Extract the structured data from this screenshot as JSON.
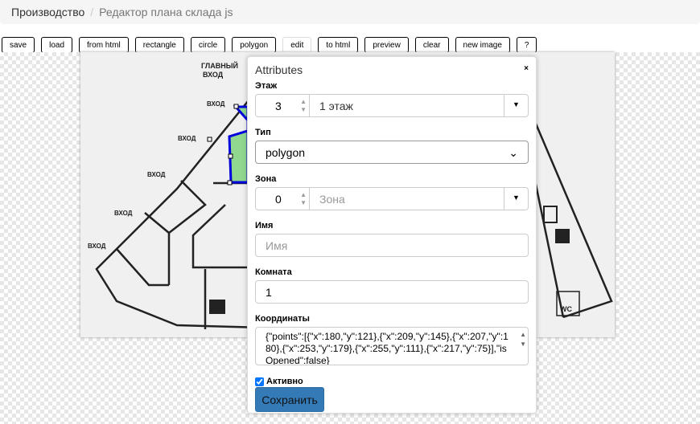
{
  "breadcrumb": {
    "root": "Производство",
    "current": "Редактор плана склада js"
  },
  "toolbar": [
    "save",
    "load",
    "from html",
    "rectangle",
    "circle",
    "polygon",
    "edit",
    "to html",
    "preview",
    "clear",
    "new image",
    "?"
  ],
  "map": {
    "main_entrance": [
      "ГЛАВНЫЙ",
      "ВХОД"
    ],
    "entrance": "ВХОД",
    "wc": "WC",
    "polygon_fill": "#90d890",
    "polygon_stroke": "#0000dd"
  },
  "panel": {
    "title": "Attributes",
    "close": "×",
    "floor": {
      "label": "Этаж",
      "number": "3",
      "value": "1 этаж"
    },
    "type": {
      "label": "Тип",
      "value": "polygon"
    },
    "zone": {
      "label": "Зона",
      "number": "0",
      "placeholder": "Зона"
    },
    "name": {
      "label": "Имя",
      "placeholder": "Имя"
    },
    "room": {
      "label": "Комната",
      "value": "1"
    },
    "coords": {
      "label": "Координаты",
      "value": "{\"points\":[{\"x\":180,\"y\":121},{\"x\":209,\"y\":145},{\"x\":207,\"y\":180},{\"x\":253,\"y\":179},{\"x\":255,\"y\":111},{\"x\":217,\"y\":75}],\"isOpened\":false}"
    },
    "active": {
      "label": "Активно",
      "checked": true
    },
    "save": "Сохранить"
  }
}
